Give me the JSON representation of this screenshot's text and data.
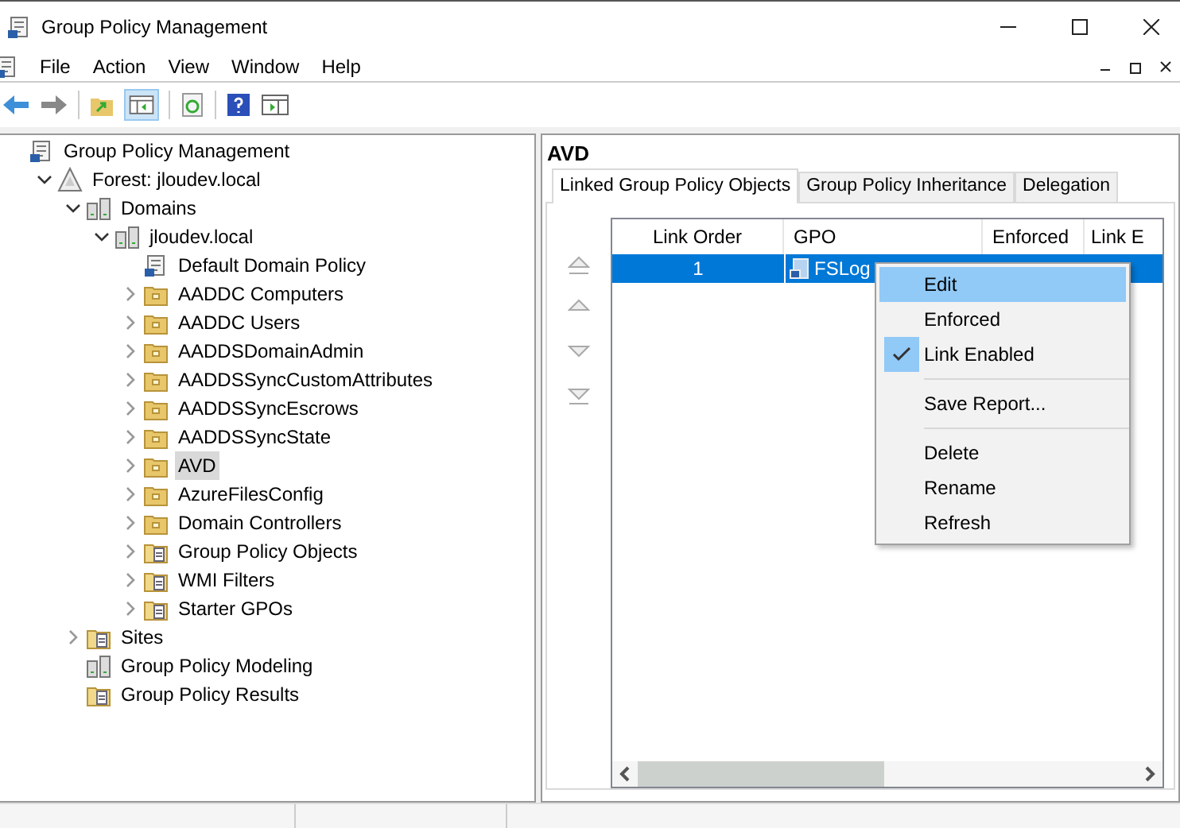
{
  "window": {
    "title": "Group Policy Management"
  },
  "menu_bar": [
    "File",
    "Action",
    "View",
    "Window",
    "Help"
  ],
  "tree": {
    "label": "Group Policy Management",
    "kind": "scroll",
    "selected": false,
    "children": [
      {
        "label": "Forest: jloudev.local",
        "kind": "forest",
        "expanded": true,
        "selected": false,
        "children": [
          {
            "label": "Domains",
            "kind": "servers",
            "expanded": true,
            "selected": false,
            "children": [
              {
                "label": "jloudev.local",
                "kind": "servers",
                "expanded": true,
                "selected": false,
                "children": [
                  {
                    "label": "Default Domain Policy",
                    "kind": "scroll",
                    "selected": false
                  },
                  {
                    "label": "AADDC Computers",
                    "kind": "folder",
                    "expanded": false,
                    "selected": false
                  },
                  {
                    "label": "AADDC Users",
                    "kind": "folder",
                    "expanded": false,
                    "selected": false
                  },
                  {
                    "label": "AADDSDomainAdmin",
                    "kind": "folder",
                    "expanded": false,
                    "selected": false
                  },
                  {
                    "label": "AADDSSyncCustomAttributes",
                    "kind": "folder",
                    "expanded": false,
                    "selected": false
                  },
                  {
                    "label": "AADDSSyncEscrows",
                    "kind": "folder",
                    "expanded": false,
                    "selected": false
                  },
                  {
                    "label": "AADDSSyncState",
                    "kind": "folder",
                    "expanded": false,
                    "selected": false
                  },
                  {
                    "label": "AVD",
                    "kind": "folder",
                    "expanded": false,
                    "selected": true
                  },
                  {
                    "label": "AzureFilesConfig",
                    "kind": "folder",
                    "expanded": false,
                    "selected": false
                  },
                  {
                    "label": "Domain Controllers",
                    "kind": "folder",
                    "expanded": false,
                    "selected": false
                  },
                  {
                    "label": "Group Policy Objects",
                    "kind": "folder-doc",
                    "expanded": false,
                    "selected": false
                  },
                  {
                    "label": "WMI Filters",
                    "kind": "folder-doc",
                    "expanded": false,
                    "selected": false
                  },
                  {
                    "label": "Starter GPOs",
                    "kind": "folder-doc",
                    "expanded": false,
                    "selected": false
                  }
                ]
              }
            ]
          },
          {
            "label": "Sites",
            "kind": "folder-doc",
            "expanded": false,
            "selected": false
          },
          {
            "label": "Group Policy Modeling",
            "kind": "servers",
            "selected": false
          },
          {
            "label": "Group Policy Results",
            "kind": "folder-doc",
            "selected": false
          }
        ]
      }
    ]
  },
  "details": {
    "heading": "AVD",
    "tabs": [
      {
        "label": "Linked Group Policy Objects",
        "selected": true
      },
      {
        "label": "Group Policy Inheritance",
        "selected": false
      },
      {
        "label": "Delegation",
        "selected": false
      }
    ],
    "table": {
      "columns": [
        "Link Order",
        "GPO",
        "Enforced",
        "Link E"
      ],
      "rows": [
        {
          "link_order": "1",
          "gpo": "FSLog",
          "selected": true
        }
      ]
    }
  },
  "context_menu": {
    "groups": [
      [
        {
          "label": "Edit",
          "selected": true,
          "checked": false
        },
        {
          "label": "Enforced",
          "selected": false,
          "checked": false
        },
        {
          "label": "Link Enabled",
          "selected": false,
          "checked": true
        }
      ],
      [
        {
          "label": "Save Report...",
          "selected": false,
          "checked": false
        }
      ],
      [
        {
          "label": "Delete",
          "selected": false,
          "checked": false
        },
        {
          "label": "Rename",
          "selected": false,
          "checked": false
        },
        {
          "label": "Refresh",
          "selected": false,
          "checked": false
        }
      ]
    ]
  }
}
